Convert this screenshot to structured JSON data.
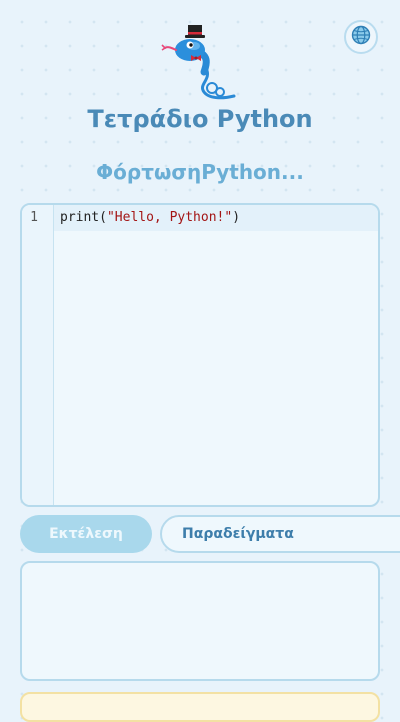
{
  "header": {
    "title": "Τετράδιο Python",
    "mascot_icon": "python-snake-mascot-icon",
    "language_icon": "globe-icon"
  },
  "status": {
    "loading_text": "ΦόρτωσηPython..."
  },
  "editor": {
    "line_numbers": [
      "1"
    ],
    "code": {
      "prefix": "print(",
      "string": "\"Hello, Python!\"",
      "suffix": ")"
    }
  },
  "controls": {
    "run_label": "Εκτέλεση",
    "examples_label": "Παραδείγματα"
  },
  "colors": {
    "accent": "#4a8ab7",
    "run_button_bg": "#a9d8ec",
    "panel_border": "#b6daec",
    "string_color": "#a31515"
  }
}
